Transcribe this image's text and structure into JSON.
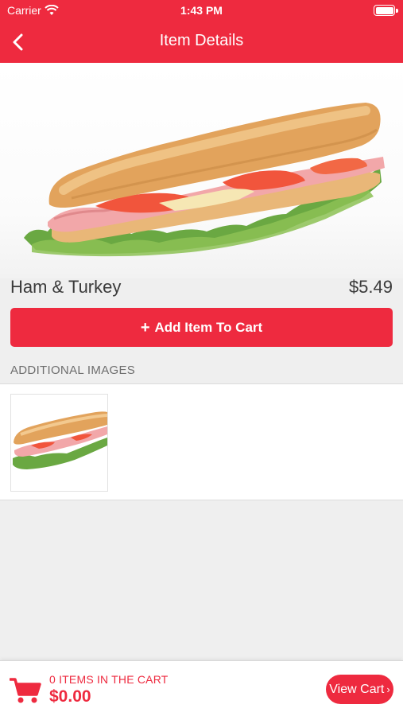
{
  "status_bar": {
    "carrier": "Carrier",
    "time": "1:43 PM"
  },
  "nav": {
    "title": "Item Details"
  },
  "item": {
    "name": "Ham & Turkey",
    "price": "$5.49"
  },
  "actions": {
    "add_to_cart_label": "Add Item To Cart"
  },
  "additional_images": {
    "header": "ADDITIONAL IMAGES"
  },
  "cart": {
    "count_label": "0 ITEMS IN THE CART",
    "total": "$0.00",
    "view_cart_label": "View Cart"
  },
  "colors": {
    "accent": "#ee2a3f",
    "background": "#efefef"
  },
  "icons": [
    "wifi-icon",
    "battery-icon",
    "back-chevron-icon",
    "plus-icon",
    "cart-icon",
    "chevron-right-icon"
  ]
}
